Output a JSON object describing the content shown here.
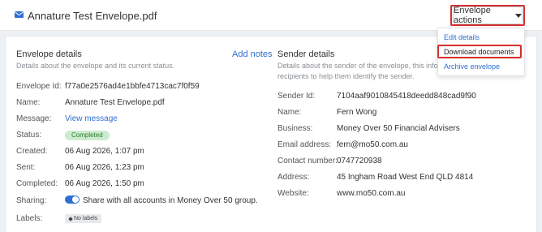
{
  "header": {
    "title": "Annature Test Envelope.pdf",
    "envelope_icon": "envelope-icon",
    "actions_label": "Envelope actions"
  },
  "envelope_details": {
    "title": "Envelope details",
    "description": "Details about the envelope and its current status.",
    "add_notes": "Add notes",
    "fields": {
      "envelope_id": {
        "label": "Envelope Id:",
        "value": "f77a0e2576ad4e1bbfe4713cac7f0f59"
      },
      "name": {
        "label": "Name:",
        "value": "Annature Test Envelope.pdf"
      },
      "message": {
        "label": "Message:",
        "value": "View message"
      },
      "status": {
        "label": "Status:",
        "value": "Completed"
      },
      "created": {
        "label": "Created:",
        "value": "06 Aug 2026, 1:07 pm"
      },
      "sent": {
        "label": "Sent:",
        "value": "06 Aug 2026, 1:23 pm"
      },
      "completed": {
        "label": "Completed:",
        "value": "06 Aug 2026, 1:50 pm"
      },
      "sharing": {
        "label": "Sharing:",
        "value": "Share with all accounts in Money Over 50 group."
      },
      "labels": {
        "label": "Labels:",
        "value": "No labels"
      }
    }
  },
  "sender_details": {
    "title": "Sender details",
    "description_line1": "Details about the sender of the envelope, this informatio",
    "description_line2": "recipients to help them identify the sender.",
    "fields": {
      "sender_id": {
        "label": "Sender Id:",
        "value": "7104aaf9010845418deedd848cad9f90"
      },
      "name": {
        "label": "Name:",
        "value": "Fern Wong"
      },
      "business": {
        "label": "Business:",
        "value": "Money Over 50 Financial Advisers"
      },
      "email": {
        "label": "Email address:",
        "value": "fern@mo50.com.au"
      },
      "contact": {
        "label": "Contact number:",
        "value": "0747720938"
      },
      "address": {
        "label": "Address:",
        "value": "45 Ingham Road West End QLD 4814"
      },
      "website": {
        "label": "Website:",
        "value": "www.mo50.com.au"
      }
    }
  },
  "dropdown": {
    "items": [
      "Edit details",
      "Download documents",
      "Archive envelope"
    ]
  },
  "colors": {
    "accent": "#2f6fd2",
    "highlight": "#d32f2f",
    "status_completed_bg": "#cdeccf",
    "status_completed_text": "#2e7d32"
  }
}
